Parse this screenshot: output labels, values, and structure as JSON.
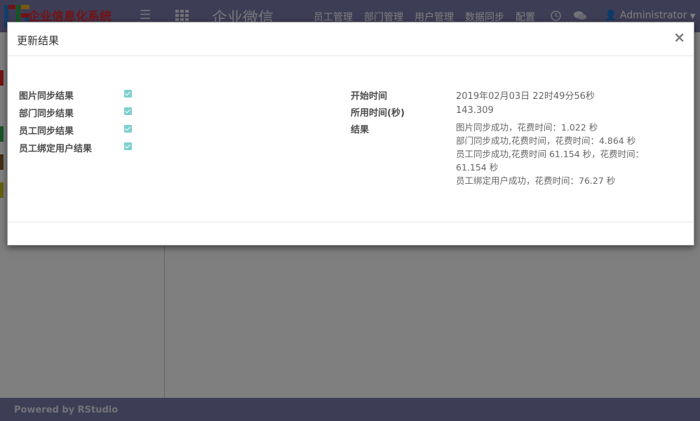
{
  "navbar": {
    "brand": "企业信息化系统",
    "app_title": "企业微信",
    "menu": [
      "员工管理",
      "部门管理",
      "用户管理",
      "数据同步",
      "配置"
    ],
    "user": "Administrator"
  },
  "footer": {
    "text": "Powered by RStudio"
  },
  "modal": {
    "title": "更新结果",
    "close": "×",
    "sync_fields": [
      {
        "label": "图片同步结果",
        "checked": true
      },
      {
        "label": "部门同步结果",
        "checked": true
      },
      {
        "label": "员工同步结果",
        "checked": true
      },
      {
        "label": "员工绑定用户结果",
        "checked": true
      }
    ],
    "start_time_label": "开始时间",
    "start_time_value": "2019年02月03日 22时49分56秒",
    "duration_label": "所用时间(秒)",
    "duration_value": "143.309",
    "result_label": "结果",
    "result_lines": [
      "图片同步成功，花费时间：1.022 秒",
      "部门同步成功,花费时间，花费时间：4.864 秒",
      "员工同步成功,花费时间 61.154 秒，花费时间：",
      "61.154 秒",
      "员工绑定用户成功，花费时间：76.27 秒"
    ]
  },
  "colors": {
    "navbar": "#7c7bad",
    "brand": "#e8262b",
    "checkbox": "#7fcfd0"
  }
}
